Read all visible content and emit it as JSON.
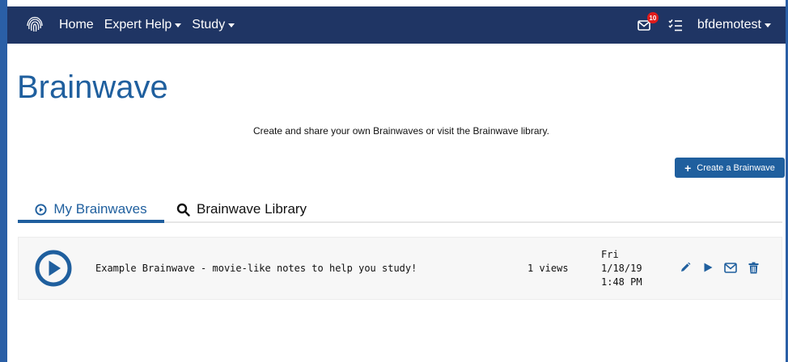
{
  "nav": {
    "home": "Home",
    "expert_help": "Expert Help",
    "study": "Study",
    "mail_badge": "10",
    "username": "bfdemotest"
  },
  "page": {
    "title": "Brainwave",
    "intro": "Create and share your own Brainwaves or visit the Brainwave library.",
    "create_button": "Create a Brainwave"
  },
  "tabs": {
    "my": "My Brainwaves",
    "library": "Brainwave Library"
  },
  "rows": [
    {
      "title": "Example Brainwave - movie-like notes to help you study!",
      "views": "1 views",
      "date_day": "Fri",
      "date": "1/18/19",
      "time": "1:48 PM"
    }
  ],
  "colors": {
    "navbar": "#1f3564",
    "accent": "#1f5f9e",
    "badge": "#e01b1b"
  },
  "icons": {
    "brand": "fingerprint-icon",
    "mail": "envelope-icon",
    "tasks": "task-list-icon",
    "tab_my": "play-circle-icon",
    "tab_library": "search-icon",
    "row_play": "play-circle-icon",
    "edit": "pencil-icon",
    "play": "play-icon",
    "share": "envelope-icon",
    "delete": "trash-icon"
  }
}
